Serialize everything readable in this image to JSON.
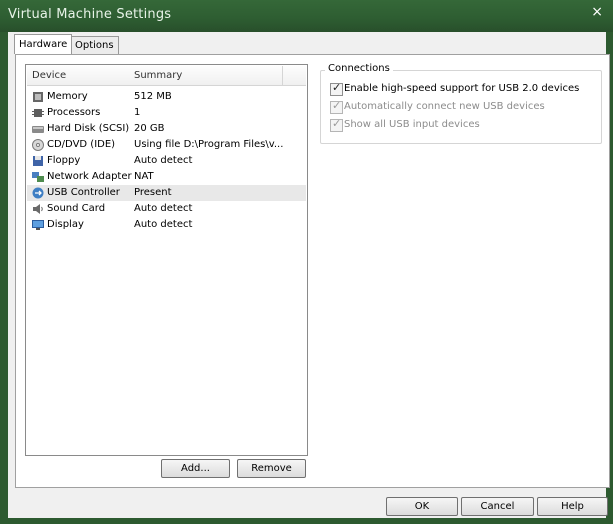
{
  "window": {
    "title": "Virtual Machine Settings",
    "close_glyph": "×"
  },
  "tabs": [
    {
      "label": "Hardware"
    },
    {
      "label": "Options"
    }
  ],
  "device_list": {
    "headers": {
      "device": "Device",
      "summary": "Summary"
    },
    "rows": [
      {
        "device": "Memory",
        "summary": "512 MB",
        "icon": "memory-icon"
      },
      {
        "device": "Processors",
        "summary": "1",
        "icon": "processor-icon"
      },
      {
        "device": "Hard Disk (SCSI)",
        "summary": "20 GB",
        "icon": "hard-disk-icon"
      },
      {
        "device": "CD/DVD (IDE)",
        "summary": "Using file D:\\Program Files\\v...",
        "icon": "cd-dvd-icon"
      },
      {
        "device": "Floppy",
        "summary": "Auto detect",
        "icon": "floppy-icon"
      },
      {
        "device": "Network Adapter",
        "summary": "NAT",
        "icon": "network-adapter-icon"
      },
      {
        "device": "USB Controller",
        "summary": "Present",
        "icon": "usb-controller-icon"
      },
      {
        "device": "Sound Card",
        "summary": "Auto detect",
        "icon": "sound-card-icon"
      },
      {
        "device": "Display",
        "summary": "Auto detect",
        "icon": "display-icon"
      }
    ]
  },
  "list_buttons": {
    "add": "Add...",
    "remove": "Remove"
  },
  "connections": {
    "title": "Connections",
    "options": [
      {
        "label": "Enable high-speed support for USB 2.0 devices",
        "checked": true,
        "enabled": true
      },
      {
        "label": "Automatically connect new USB devices",
        "checked": true,
        "enabled": false
      },
      {
        "label": "Show all USB input devices",
        "checked": true,
        "enabled": false
      }
    ]
  },
  "dialog_buttons": {
    "ok": "OK",
    "cancel": "Cancel",
    "help": "Help"
  }
}
